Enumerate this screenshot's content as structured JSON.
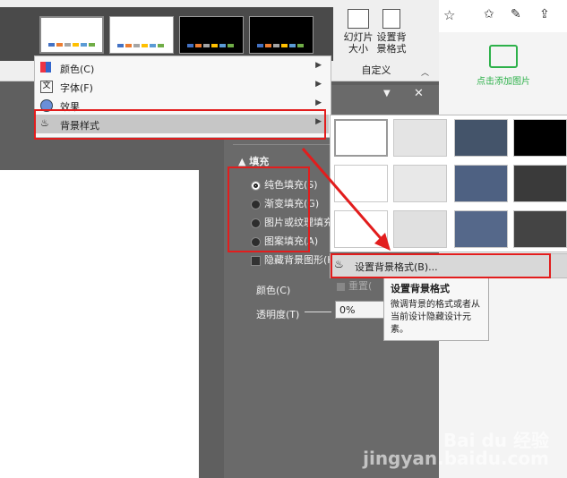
{
  "ribbon": {
    "slide_size_label": "幻灯片\n大小",
    "set_bg_label": "设置背\n景格式",
    "group_label": "自定义"
  },
  "menu": {
    "items": [
      {
        "label": "颜色(C)"
      },
      {
        "label": "字体(F)"
      },
      {
        "label": "效果"
      },
      {
        "label": "背景样式"
      }
    ]
  },
  "pane": {
    "section_fill": "填充",
    "options": [
      {
        "label": "纯色填充(S)"
      },
      {
        "label": "渐变填充(G)"
      },
      {
        "label": "图片或纹理填充("
      },
      {
        "label": "图案填充(A)"
      }
    ],
    "hide_bg": "隐藏背景图形(H)",
    "reset": "重置(",
    "color_label": "颜色(C)",
    "transparency_label": "透明度(T)",
    "transparency_value": "0%"
  },
  "submenu": {
    "set_bg_format": "设置背景格式(B)..."
  },
  "tooltip": {
    "title": "设置背景格式",
    "body": "微调背景的格式或者从当前设计隐藏设计元素。"
  },
  "browser": {
    "add_image": "点击添加图片"
  },
  "watermark": "Bai du 经验\njingyan.baidu.com",
  "colors": {
    "highlight_red": "#e21d1d",
    "accent_green": "#2db14a"
  }
}
